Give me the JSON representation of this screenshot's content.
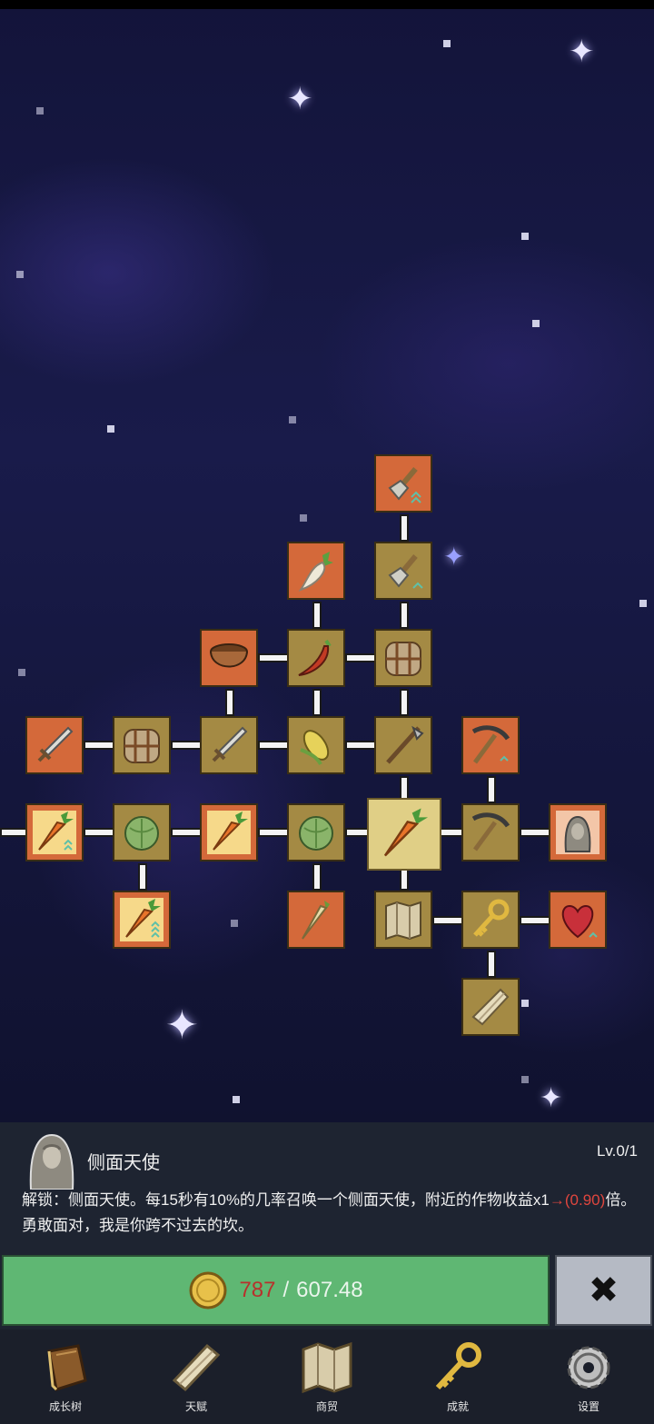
{
  "panel": {
    "title": "侧面天使",
    "level": "Lv.0/1",
    "desc_main": "解锁：侧面天使。每15秒有10%的几率召唤一个侧面天使，附近的作物收益x1",
    "desc_arrow": "→(0.90)",
    "desc_tail": "倍。勇敢面对，我是你跨不过去的坎。"
  },
  "purchase": {
    "have": "787",
    "separator": "/",
    "cost": "607.48"
  },
  "close_icon": "close-x-icon",
  "nav": [
    {
      "label": "成长树",
      "icon": "book-icon"
    },
    {
      "label": "天赋",
      "icon": "scroll-icon"
    },
    {
      "label": "商贸",
      "icon": "map-icon"
    },
    {
      "label": "成就",
      "icon": "key-icon"
    },
    {
      "label": "设置",
      "icon": "gear-icon"
    }
  ],
  "tree_nodes": [
    {
      "icon": "shovel-icon",
      "style": "orange"
    },
    {
      "icon": "radish-icon",
      "style": "orange"
    },
    {
      "icon": "shovel-icon",
      "style": "tan"
    },
    {
      "icon": "bowl-icon",
      "style": "orange"
    },
    {
      "icon": "chili-icon",
      "style": "tan"
    },
    {
      "icon": "backpack-icon",
      "style": "tan"
    },
    {
      "icon": "sword-icon",
      "style": "orange"
    },
    {
      "icon": "backpack-icon",
      "style": "tan"
    },
    {
      "icon": "sword-icon",
      "style": "tan"
    },
    {
      "icon": "corn-icon",
      "style": "tan"
    },
    {
      "icon": "hoe-icon",
      "style": "tan"
    },
    {
      "icon": "pickaxe-icon",
      "style": "orange"
    },
    {
      "icon": "carrot-icon",
      "style": "orange"
    },
    {
      "icon": "cabbage-icon",
      "style": "tan"
    },
    {
      "icon": "carrot-icon",
      "style": "orange"
    },
    {
      "icon": "cabbage-icon",
      "style": "tan"
    },
    {
      "icon": "carrot-icon",
      "style": "selected"
    },
    {
      "icon": "pickaxe-icon",
      "style": "tan"
    },
    {
      "icon": "angel-icon",
      "style": "orange"
    },
    {
      "icon": "carrot-icon",
      "style": "orange"
    },
    {
      "icon": "parsnip-icon",
      "style": "orange"
    },
    {
      "icon": "map-icon",
      "style": "tan"
    },
    {
      "icon": "key-icon",
      "style": "tan"
    },
    {
      "icon": "heart-icon",
      "style": "orange"
    },
    {
      "icon": "scroll-icon",
      "style": "tan"
    }
  ]
}
